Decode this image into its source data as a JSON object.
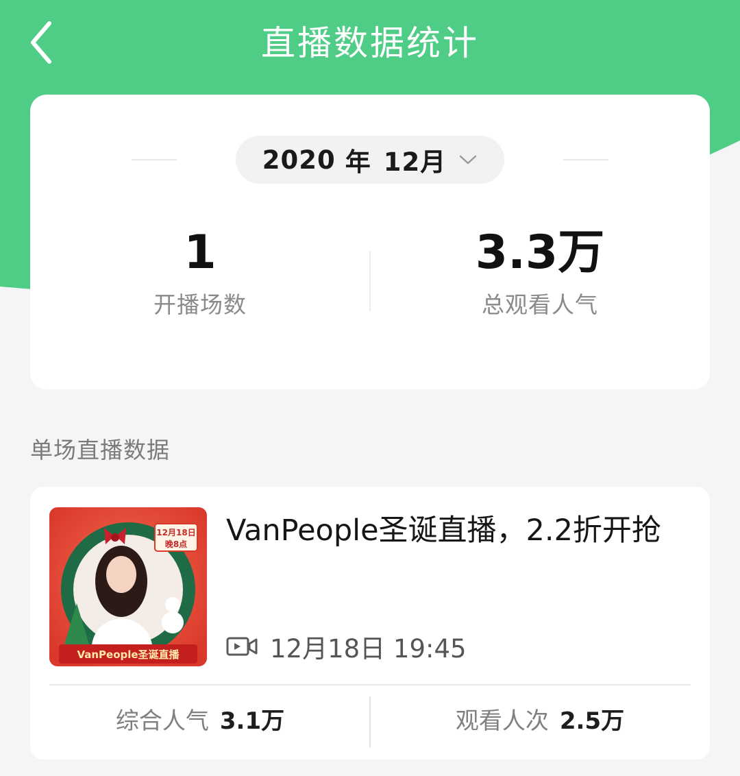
{
  "header": {
    "title": "直播数据统计",
    "back_icon": "chevron-left-icon",
    "background_color": "#4fcc85"
  },
  "summary": {
    "month_selector": {
      "year": "2020",
      "year_unit": "年",
      "month": "12月"
    },
    "stats": [
      {
        "value": "1",
        "label": "开播场数"
      },
      {
        "value": "3.3万",
        "label": "总观看人气"
      }
    ]
  },
  "section": {
    "title": "单场直播数据"
  },
  "sessions": [
    {
      "title": "VanPeople圣诞直播，2.2折开抢",
      "time": "12月18日 19:45",
      "time_icon": "video-camera-icon",
      "cover": {
        "date_badge": "12月18日",
        "time_badge": "晚8点",
        "banner_text": "VanPeople圣诞直播"
      },
      "metrics": [
        {
          "label": "综合人气",
          "value": "3.1万"
        },
        {
          "label": "观看人次",
          "value": "2.5万"
        }
      ]
    }
  ]
}
